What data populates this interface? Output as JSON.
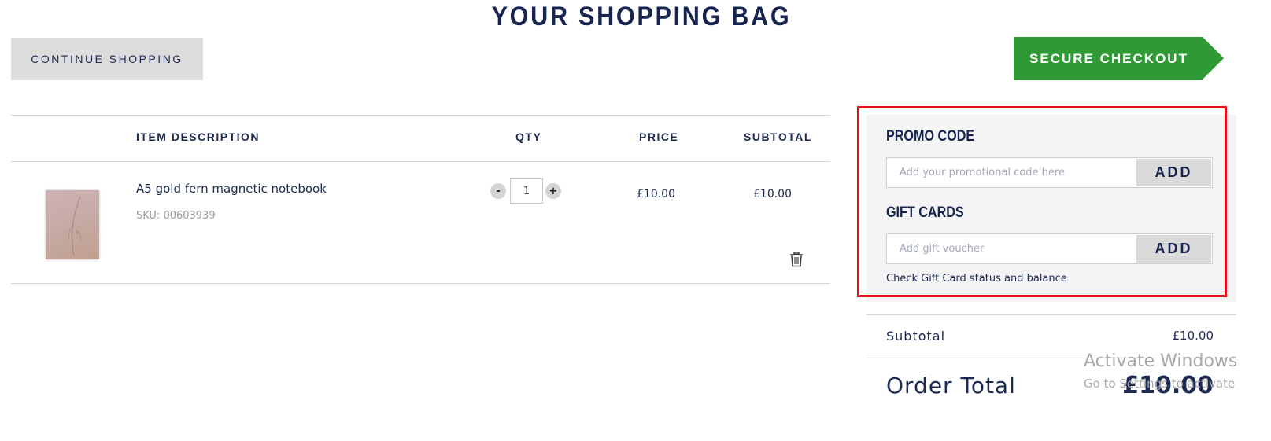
{
  "page": {
    "title": "YOUR SHOPPING BAG"
  },
  "actions": {
    "continue_label": "CONTINUE SHOPPING",
    "checkout_label": "SECURE CHECKOUT"
  },
  "table": {
    "headers": {
      "description": "ITEM DESCRIPTION",
      "qty": "QTY",
      "price": "PRICE",
      "subtotal": "SUBTOTAL"
    },
    "items": [
      {
        "name": "A5 gold fern magnetic notebook",
        "sku": "SKU: 00603939",
        "qty": "1",
        "price": "£10.00",
        "subtotal": "£10.00",
        "minus": "-",
        "plus": "+"
      }
    ]
  },
  "promo": {
    "heading": "PROMO CODE",
    "placeholder": "Add your promotional code here",
    "add_label": "ADD"
  },
  "gift": {
    "heading": "GIFT CARDS",
    "placeholder": "Add gift voucher",
    "add_label": "ADD",
    "status_link": "Check Gift Card status and balance"
  },
  "summary": {
    "subtotal_label": "Subtotal",
    "subtotal_value": "£10.00",
    "total_label": "Order Total",
    "total_value": "£10.00"
  },
  "watermark": {
    "line1": "Activate Windows",
    "line2": "Go to Settings to activate"
  },
  "colors": {
    "navy": "#16244f",
    "checkout_green": "#2f9a35",
    "highlight_red": "#e8101a",
    "panel_bg": "#f4f4f4"
  }
}
